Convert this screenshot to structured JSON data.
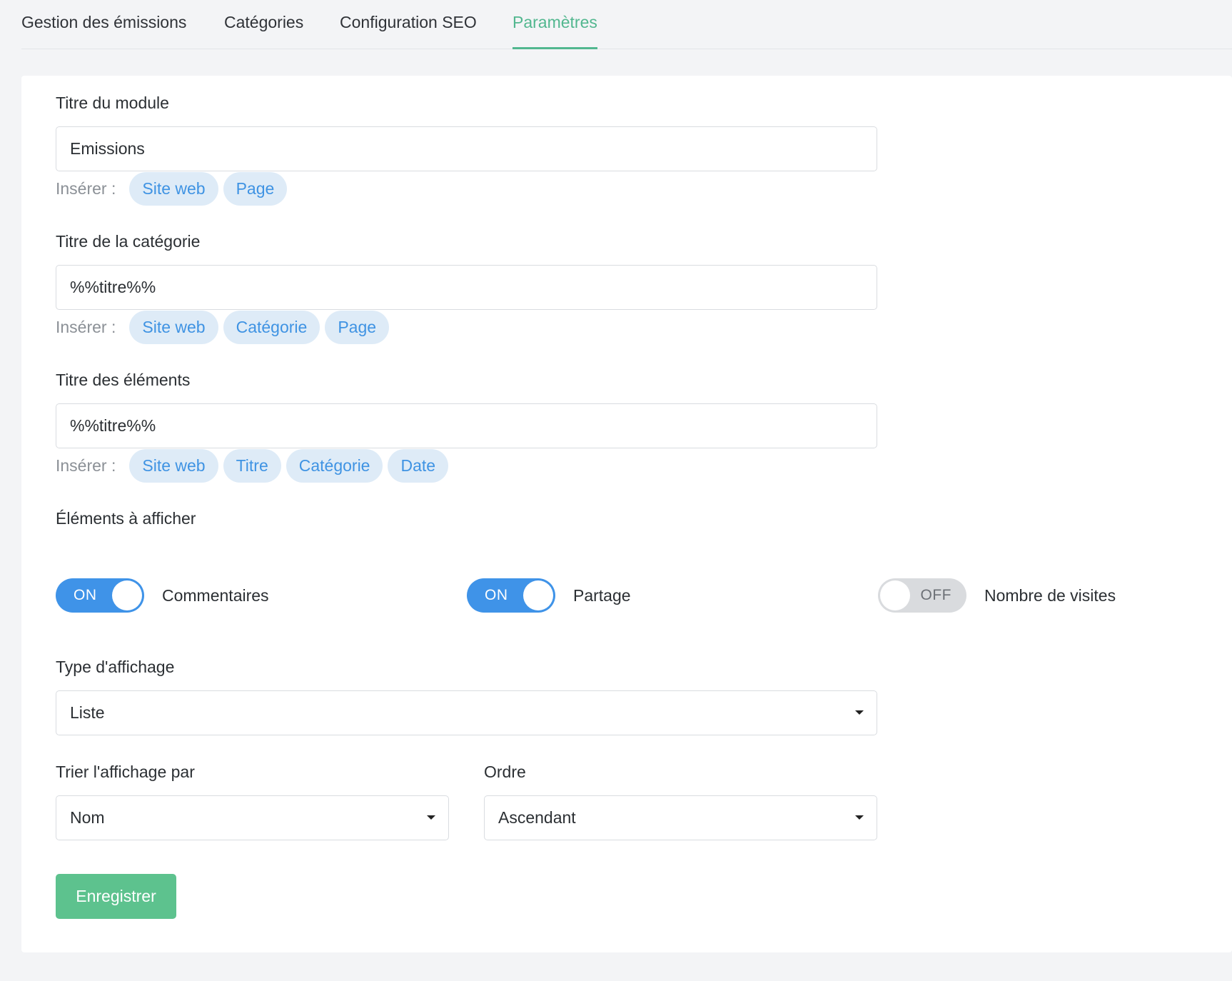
{
  "tabs": [
    {
      "label": "Gestion des émissions"
    },
    {
      "label": "Catégories"
    },
    {
      "label": "Configuration SEO"
    },
    {
      "label": "Paramètres",
      "active": true
    }
  ],
  "form": {
    "module_title": {
      "label": "Titre du module",
      "value": "Emissions",
      "insert_label": "Insérer :",
      "chips": [
        "Site web",
        "Page"
      ]
    },
    "category_title": {
      "label": "Titre de la catégorie",
      "value": "%%titre%%",
      "insert_label": "Insérer :",
      "chips": [
        "Site web",
        "Catégorie",
        "Page"
      ]
    },
    "items_title": {
      "label": "Titre des éléments",
      "value": "%%titre%%",
      "insert_label": "Insérer :",
      "chips": [
        "Site web",
        "Titre",
        "Catégorie",
        "Date"
      ]
    },
    "display_elements": {
      "label": "Éléments à afficher",
      "toggles": [
        {
          "name": "Commentaires",
          "state": "ON"
        },
        {
          "name": "Partage",
          "state": "ON"
        },
        {
          "name": "Nombre de visites",
          "state": "OFF"
        }
      ]
    },
    "display_type": {
      "label": "Type d'affichage",
      "value": "Liste"
    },
    "sort_by": {
      "label": "Trier l'affichage par",
      "value": "Nom"
    },
    "order": {
      "label": "Ordre",
      "value": "Ascendant"
    },
    "save_label": "Enregistrer"
  },
  "colors": {
    "accent_green": "#52b78f",
    "toggle_on": "#3f93e8",
    "chip_bg": "#deebf7",
    "chip_text": "#3f93e3",
    "save_button": "#5dc28e"
  }
}
